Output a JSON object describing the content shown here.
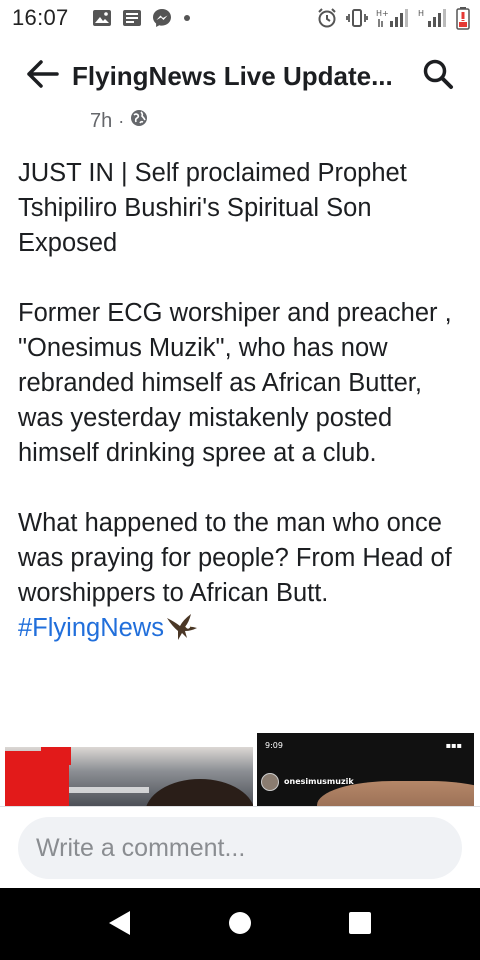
{
  "status_bar": {
    "time": "16:07",
    "left_icons": [
      "gallery-icon",
      "news-icon",
      "messenger-icon",
      "dot-icon"
    ],
    "right_icons": [
      "alarm-icon",
      "vibrate-icon",
      "signal-h-plus-icon",
      "signal-h-icon",
      "battery-low-icon"
    ],
    "net_label_1": "H+",
    "net_label_2": "H"
  },
  "header": {
    "title": "FlyingNews Live Update...",
    "back_icon": "back-arrow-icon",
    "search_icon": "search-icon"
  },
  "post": {
    "time_ago": "7h",
    "separator": "·",
    "privacy_icon": "globe-icon",
    "paragraph_1": "JUST IN | Self proclaimed Prophet Tshipiliro Bushiri's Spiritual Son Exposed",
    "paragraph_2": "Former ECG worshiper and preacher  , \"Onesimus Muzik\", who has now rebranded himself as African Butter, was yesterday mistakenly posted himself drinking spree at a club.",
    "paragraph_3": "What happened to the man who once was praying for people? From Head of worshippers to African Butt.",
    "hashtag": "#FlyingNews",
    "hashtag_emoji_icon": "eagle-icon",
    "colors": {
      "hashtag": "#216fdb",
      "text": "#1c1e21",
      "meta": "#65676b"
    }
  },
  "media": {
    "right_image_status_time": "9:09",
    "right_image_username": "onesimusmuzik"
  },
  "comment": {
    "placeholder": "Write a comment..."
  },
  "nav": {
    "icons": [
      "nav-back-icon",
      "nav-home-icon",
      "nav-recents-icon"
    ]
  }
}
